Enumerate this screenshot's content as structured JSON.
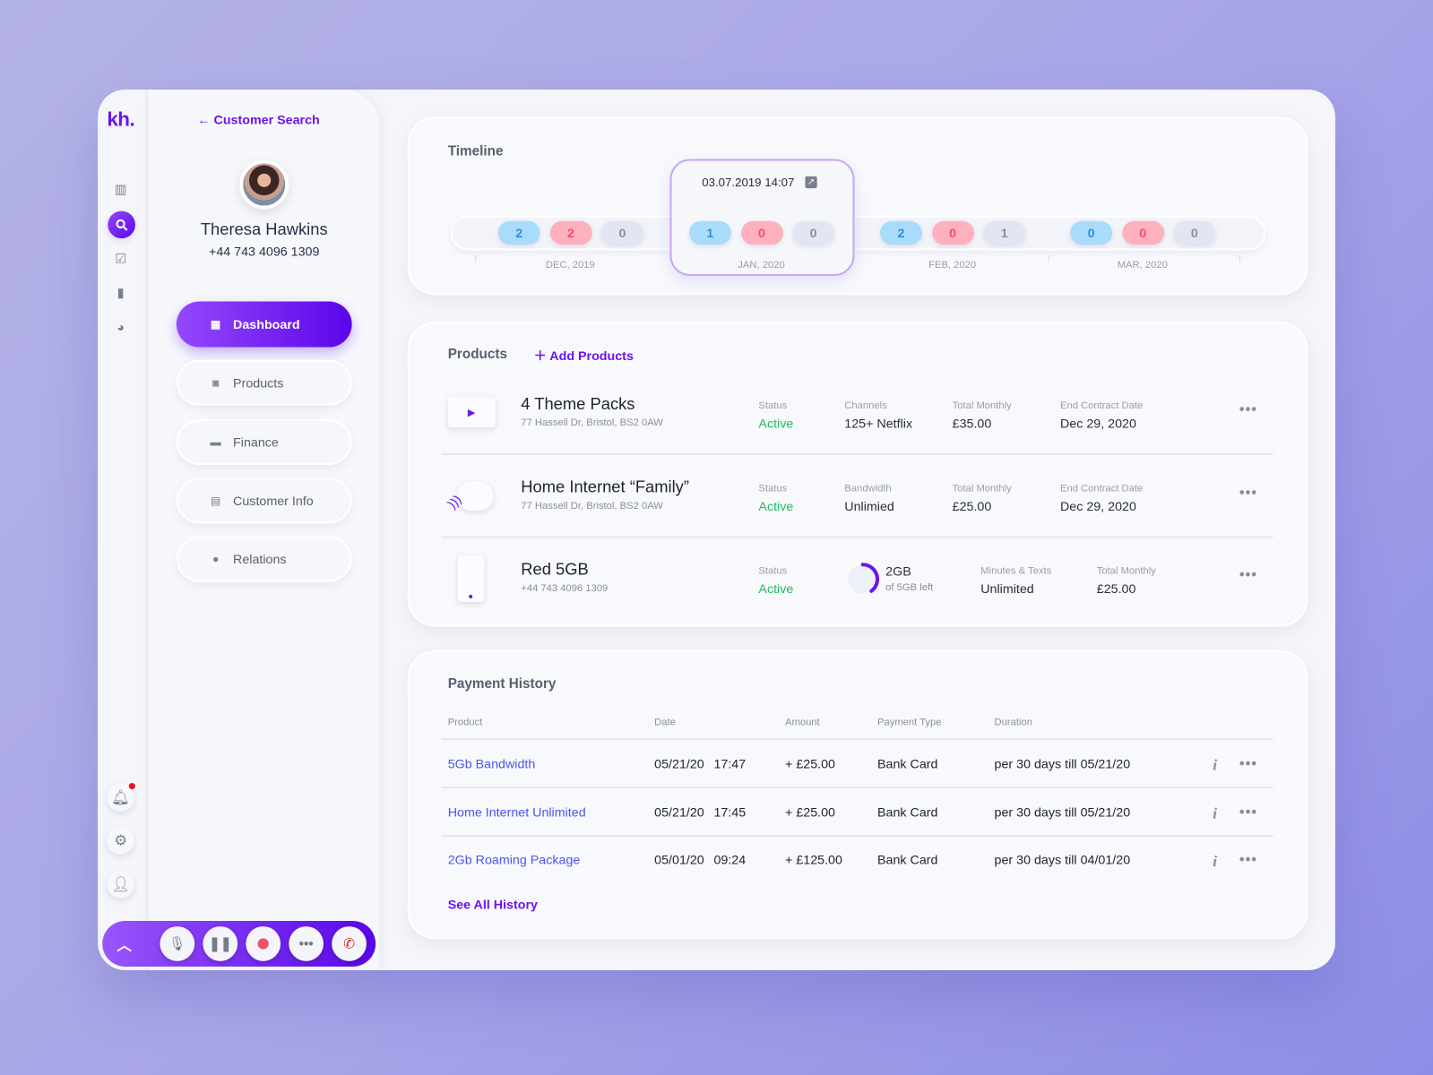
{
  "brand": {
    "logo": "kh."
  },
  "rail": {
    "icons": [
      "bar-chart-icon",
      "search-icon",
      "clipboard-check-icon",
      "book-icon",
      "pie-chart-icon"
    ],
    "bottom_icons": [
      "bell-icon",
      "gear-icon",
      "user-icon"
    ],
    "notification_color": "#e8141e"
  },
  "customer": {
    "back_label": "Customer Search",
    "name": "Theresa Hawkins",
    "phone": "+44 743 4096 1309"
  },
  "nav": [
    {
      "label": "Dashboard",
      "icon": "grid-icon",
      "active": true
    },
    {
      "label": "Products",
      "icon": "bag-icon"
    },
    {
      "label": "Finance",
      "icon": "wallet-icon"
    },
    {
      "label": "Customer Info",
      "icon": "document-icon"
    },
    {
      "label": "Relations",
      "icon": "chat-icon"
    }
  ],
  "call_bar": {
    "buttons": [
      "chevron-up-icon",
      "microphone-icon",
      "pause-icon",
      "record-icon",
      "more-icon",
      "phone-icon"
    ]
  },
  "timeline": {
    "title": "Timeline",
    "selected_timestamp": "03.07.2019 14:07",
    "months": [
      {
        "label": "DEC, 2019",
        "counts": [
          "2",
          "2",
          "0"
        ]
      },
      {
        "label": "JAN, 2020",
        "counts": [
          "1",
          "0",
          "0"
        ],
        "selected": true
      },
      {
        "label": "FEB, 2020",
        "counts": [
          "2",
          "0",
          "1"
        ]
      },
      {
        "label": "MAR, 2020",
        "counts": [
          "0",
          "0",
          "0"
        ]
      }
    ],
    "colors": {
      "blue": "#a9dcfb",
      "red": "#fdb1bd",
      "gray": "#e2e6f4"
    }
  },
  "products": {
    "title": "Products",
    "add_label": "Add Products",
    "items": [
      {
        "name": "4 Theme Packs",
        "sub": "77 Hassell Dr, Bristol, BS2 0AW",
        "icon": "tv-play-icon",
        "fields": [
          {
            "label": "Status",
            "value": "Active"
          },
          {
            "label": "Channels",
            "value": "125+ Netflix"
          },
          {
            "label": "Total Monthly",
            "value": "£35.00"
          },
          {
            "label": "End Contract Date",
            "value": "Dec 29, 2020"
          }
        ]
      },
      {
        "name": "Home Internet “Family”",
        "sub": "77 Hassell Dr, Bristol, BS2 0AW",
        "icon": "cloud-wifi-icon",
        "fields": [
          {
            "label": "Status",
            "value": "Active"
          },
          {
            "label": "Bandwidth",
            "value": "Unlimied"
          },
          {
            "label": "Total Monthly",
            "value": "£25.00"
          },
          {
            "label": "End Contract Date",
            "value": "Dec 29, 2020"
          }
        ]
      },
      {
        "name": "Red 5GB",
        "sub": "+44 743 4096 1309",
        "icon": "phone-device-icon",
        "fields": [
          {
            "label": "Status",
            "value": "Active"
          },
          {
            "label": "Minutes & Texts",
            "value": "Unlimited"
          },
          {
            "label": "Total Monthly",
            "value": "£25.00"
          }
        ],
        "data_usage": {
          "value": "2GB",
          "sub": "of 5GB left",
          "fraction_left": 0.4
        }
      }
    ]
  },
  "payments": {
    "title": "Payment History",
    "columns": [
      "Product",
      "Date",
      "Amount",
      "Payment Type",
      "Duration"
    ],
    "rows": [
      {
        "product": "5Gb Bandwidth",
        "date": "05/21/20",
        "time": "17:47",
        "amount": "+ £25.00",
        "type": "Bank Card",
        "duration": "per 30 days till 05/21/20"
      },
      {
        "product": "Home Internet Unlimited",
        "date": "05/21/20",
        "time": "17:45",
        "amount": "+ £25.00",
        "type": "Bank Card",
        "duration": "per 30 days till 05/21/20"
      },
      {
        "product": "2Gb Roaming Package",
        "date": "05/01/20",
        "time": "09:24",
        "amount": "+ £125.00",
        "type": "Bank Card",
        "duration": "per 30 days till 04/01/20"
      }
    ],
    "see_all": "See All History"
  },
  "colors": {
    "accent": "#6a13f0",
    "active": "#21b961",
    "link": "#4b55f0"
  }
}
